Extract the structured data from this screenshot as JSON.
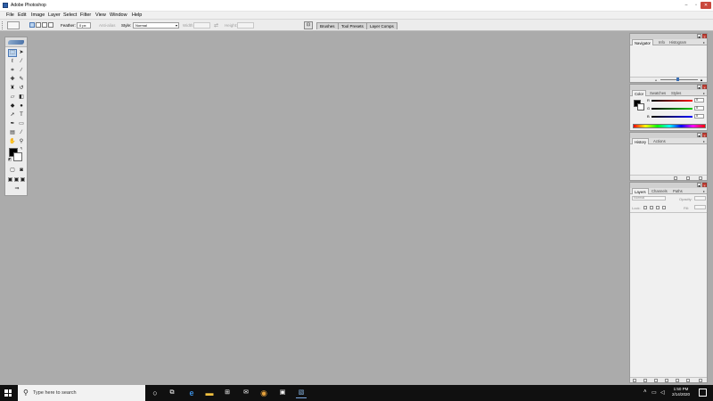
{
  "window": {
    "title": "Adobe Photoshop"
  },
  "menu": [
    "File",
    "Edit",
    "Image",
    "Layer",
    "Select",
    "Filter",
    "View",
    "Window",
    "Help"
  ],
  "options": {
    "feather_label": "Feather:",
    "feather_value": "0 px",
    "antialias_label": "Anti-alias",
    "style_label": "Style:",
    "style_value": "Normal",
    "width_label": "Width:",
    "height_label": "Height:"
  },
  "palette_well_tabs": [
    "Brushes",
    "Tool Presets",
    "Layer Comps"
  ],
  "palettes": {
    "navigator": {
      "tabs": [
        "Navigator",
        "Info",
        "Histogram"
      ]
    },
    "color": {
      "tabs": [
        "Color",
        "Swatches",
        "Styles"
      ],
      "channels": [
        {
          "label": "R",
          "value": "0"
        },
        {
          "label": "G",
          "value": "0"
        },
        {
          "label": "B",
          "value": "0"
        }
      ]
    },
    "history": {
      "tabs": [
        "History",
        "Actions"
      ]
    },
    "layers": {
      "tabs": [
        "Layers",
        "Channels",
        "Paths"
      ],
      "blend_mode": "Normal",
      "opacity_label": "Opacity:",
      "lock_label": "Lock:",
      "fill_label": "Fill:"
    }
  },
  "taskbar": {
    "search_placeholder": "Type here to search",
    "time": "1:50 PM",
    "date": "2/14/2020"
  },
  "colors": {
    "canvas": "#ababab",
    "taskbar": "#101010",
    "close": "#c9483d"
  }
}
